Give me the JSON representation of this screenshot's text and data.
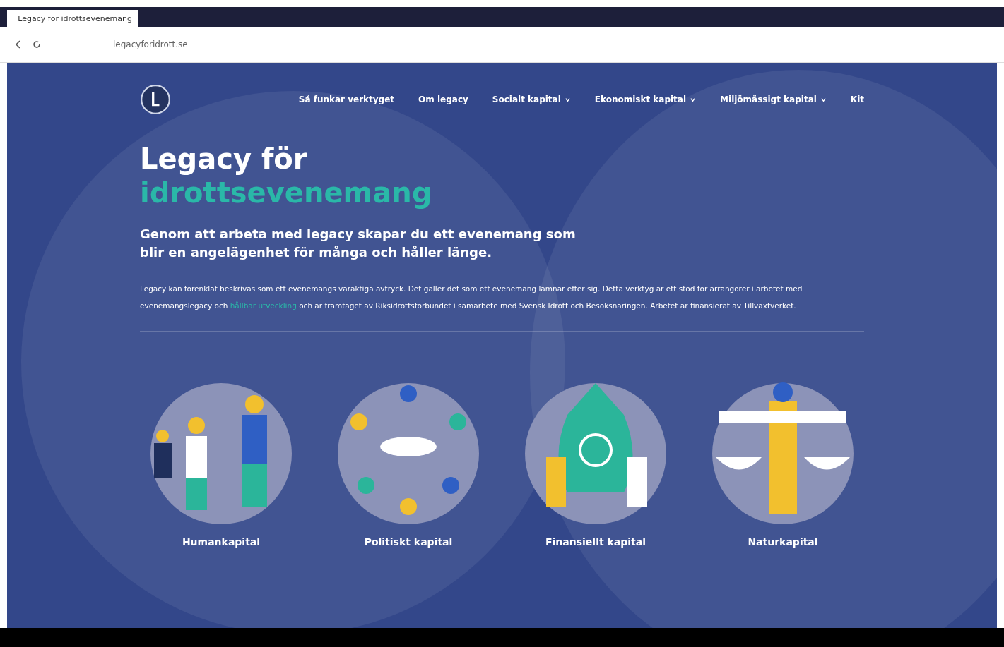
{
  "browser": {
    "tab_title": "Legacy för idrottsevenemang",
    "url": "legacyforidrott.se"
  },
  "nav": {
    "items": [
      {
        "label": "Så funkar verktyget",
        "dropdown": false
      },
      {
        "label": "Om legacy",
        "dropdown": false
      },
      {
        "label": "Socialt kapital",
        "dropdown": true
      },
      {
        "label": "Ekonomiskt kapital",
        "dropdown": true
      },
      {
        "label": "Miljömässigt kapital",
        "dropdown": true
      },
      {
        "label": "Kit",
        "dropdown": false
      }
    ]
  },
  "hero": {
    "title": "Legacy för",
    "title_accent": "idrottsevenemang",
    "lead": "Genom att arbeta med legacy skapar du ett evenemang som blir en angelägenhet för många och håller länge.",
    "body_before": "Legacy kan förenklat beskrivas som ett evenemangs varaktiga avtryck. Det gäller det som ett evenemang lämnar efter sig. Detta verktyg är ett stöd för arrangörer i arbetet med evenemangslegacy och",
    "link": "hållbar utveckling",
    "body_after": "och är framtaget av Riksidrottsförbundet i samarbete med Svensk Idrott och Besöksnäringen. Arbetet är finansierat av Tillväxtverket."
  },
  "capitals": [
    {
      "label": "Humankapital",
      "kind": "people"
    },
    {
      "label": "Politiskt kapital",
      "kind": "circle"
    },
    {
      "label": "Finansiellt kapital",
      "kind": "money"
    },
    {
      "label": "Naturkapital",
      "kind": "scale"
    }
  ]
}
